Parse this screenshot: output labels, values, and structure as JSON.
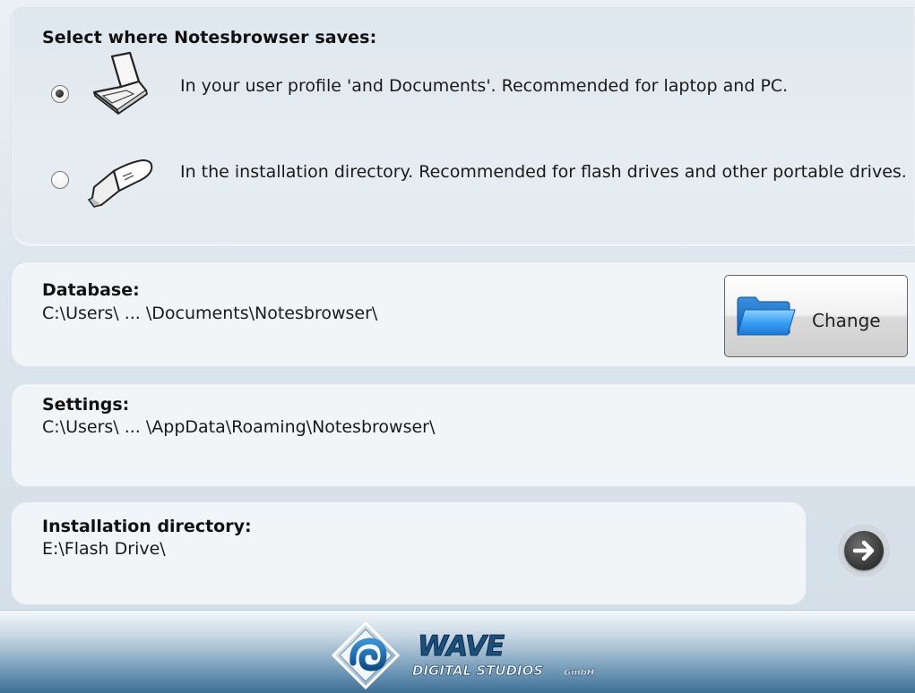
{
  "save_location": {
    "title": "Select where Notesbrowser saves:",
    "options": [
      {
        "icon": "laptop-icon",
        "selected": true,
        "text": "In your user profile 'and Documents'. Recommended for laptop and PC."
      },
      {
        "icon": "usb-flash-drive-icon",
        "selected": false,
        "text": "In the installation directory. Recommended for flash drives and other portable drives."
      }
    ]
  },
  "database": {
    "label": "Database:",
    "path": "C:\\Users\\  ...  \\Documents\\Notesbrowser\\",
    "change_label": "Change"
  },
  "settings": {
    "label": "Settings:",
    "path": "C:\\Users\\  ...  \\AppData\\Roaming\\Notesbrowser\\"
  },
  "installation": {
    "label": "Installation directory:",
    "path": "E:\\Flash Drive\\"
  },
  "footer": {
    "logo_word": "WAVE",
    "logo_sub": "DIGITAL STUDIOS",
    "logo_suffix": "GmbH"
  }
}
